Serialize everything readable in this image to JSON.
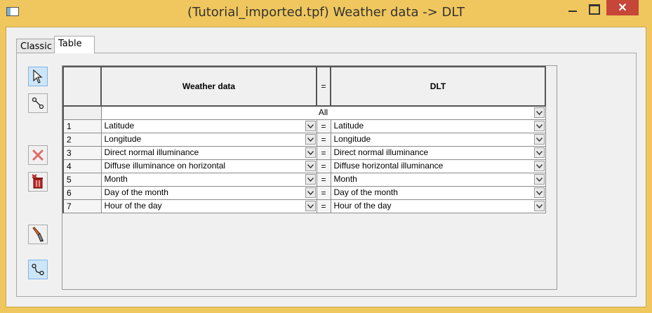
{
  "window": {
    "title": "(Tutorial_imported.tpf) Weather data -> DLT",
    "close_glyph": "✕"
  },
  "tabs": [
    {
      "label": "Classic"
    },
    {
      "label": "Table"
    }
  ],
  "toolbar": {
    "tools": [
      "pointer-icon",
      "link-icon",
      "delete-icon",
      "delete-all-icon",
      "brush-icon",
      "connect-icon"
    ]
  },
  "grid": {
    "header": {
      "left": "Weather data",
      "eq": "=",
      "right": "DLT"
    },
    "all_label": "All",
    "rows": [
      {
        "num": "1",
        "left": "Latitude",
        "eq": "=",
        "right": "Latitude"
      },
      {
        "num": "2",
        "left": "Longitude",
        "eq": "=",
        "right": "Longitude"
      },
      {
        "num": "3",
        "left": "Direct normal illuminance",
        "eq": "=",
        "right": "Direct normal illuminance"
      },
      {
        "num": "4",
        "left": "Diffuse illuminance on horizontal",
        "eq": "=",
        "right": "Diffuse horizontal illuminance"
      },
      {
        "num": "5",
        "left": "Month",
        "eq": "=",
        "right": "Month"
      },
      {
        "num": "6",
        "left": "Day of the month",
        "eq": "=",
        "right": "Day of the month"
      },
      {
        "num": "7",
        "left": "Hour of the day",
        "eq": "=",
        "right": "Hour of the day"
      }
    ]
  },
  "colors": {
    "titlebar": "#f0c75e",
    "close_button": "#c7463a",
    "selected_tool": "#cde6f7"
  }
}
